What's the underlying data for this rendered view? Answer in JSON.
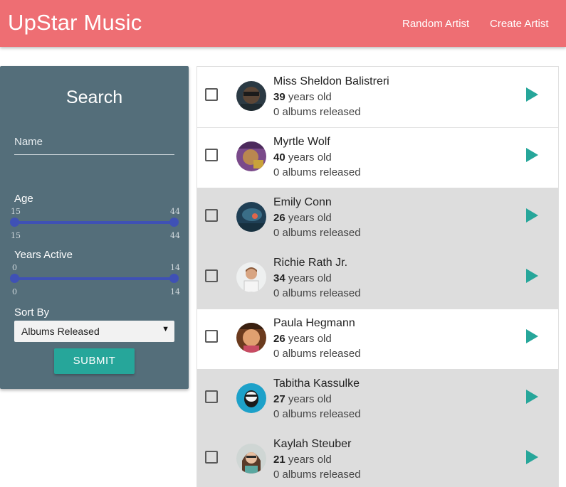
{
  "navbar": {
    "brand": "UpStar Music",
    "links": [
      "Random Artist",
      "Create Artist"
    ]
  },
  "search": {
    "title": "Search",
    "name_placeholder": "Name",
    "name_value": "",
    "age": {
      "label": "Age",
      "min": "15",
      "max": "44",
      "low": "15",
      "high": "44"
    },
    "years_active": {
      "label": "Years Active",
      "min": "0",
      "max": "14",
      "low": "0",
      "high": "14"
    },
    "sort": {
      "label": "Sort By",
      "selected": "Albums Released"
    },
    "submit_label": "SUBMIT"
  },
  "colors": {
    "navbar": "#ee6e73",
    "panel": "#546e7a",
    "accent": "#26a69a",
    "slider": "#3f51b5"
  },
  "artists": [
    {
      "name": "Miss Sheldon Balistreri",
      "age": "39",
      "age_suffix": " years old",
      "albums": "0 albums released",
      "selected": false
    },
    {
      "name": "Myrtle Wolf",
      "age": "40",
      "age_suffix": " years old",
      "albums": "0 albums released",
      "selected": false
    },
    {
      "name": "Emily Conn",
      "age": "26",
      "age_suffix": " years old",
      "albums": "0 albums released",
      "selected": true
    },
    {
      "name": "Richie Rath Jr.",
      "age": "34",
      "age_suffix": " years old",
      "albums": "0 albums released",
      "selected": true
    },
    {
      "name": "Paula Hegmann",
      "age": "26",
      "age_suffix": " years old",
      "albums": "0 albums released",
      "selected": false
    },
    {
      "name": "Tabitha Kassulke",
      "age": "27",
      "age_suffix": " years old",
      "albums": "0 albums released",
      "selected": true
    },
    {
      "name": "Kaylah Steuber",
      "age": "21",
      "age_suffix": " years old",
      "albums": "0 albums released",
      "selected": true
    }
  ]
}
